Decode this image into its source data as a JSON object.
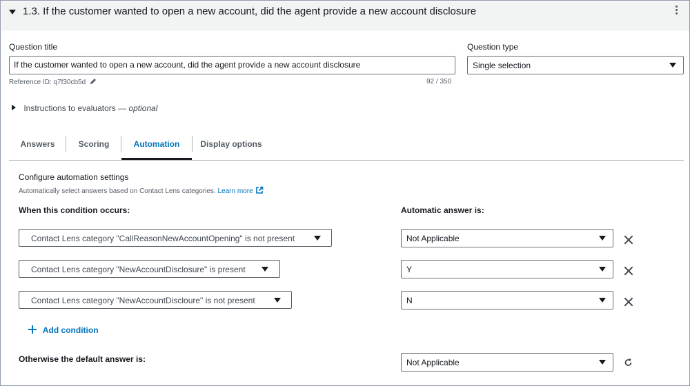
{
  "section": {
    "title": "1.3. If the customer wanted to open a new account, did the agent provide a new account disclosure",
    "menu_icon": "kebab-icon"
  },
  "question_title": {
    "label": "Question title",
    "value": "If the customer wanted to open a new account, did the agent provide a new account disclosure",
    "reference_id": "Reference ID: q7f30cb5d",
    "char_count": "92 / 350"
  },
  "question_type": {
    "label": "Question type",
    "value": "Single selection"
  },
  "instructions": {
    "label": "Instructions to evaluators",
    "optional": "— optional"
  },
  "tabs": [
    {
      "label": "Answers"
    },
    {
      "label": "Scoring"
    },
    {
      "label": "Automation"
    },
    {
      "label": "Display options"
    }
  ],
  "active_tab": "Automation",
  "automation": {
    "heading": "Configure automation settings",
    "description": "Automatically select answers based on Contact Lens categories.",
    "learn_more": "Learn more",
    "condition_header": "When this condition occurs:",
    "answer_header": "Automatic answer is:",
    "rows": [
      {
        "condition": "Contact Lens category \"CallReasonNewAccountOpening\" is not present",
        "answer": "Not Applicable"
      },
      {
        "condition": "Contact Lens category \"NewAccountDisclosure\" is present",
        "answer": "Y"
      },
      {
        "condition": "Contact Lens category \"NewAccountDiscloure\" is not present",
        "answer": "N"
      }
    ],
    "add_condition": "Add condition",
    "default_label": "Otherwise the default answer is:",
    "default_value": "Not Applicable"
  },
  "colors": {
    "accent": "#0073bb",
    "header_bg": "#f2f3f3",
    "text": "#16191f"
  }
}
